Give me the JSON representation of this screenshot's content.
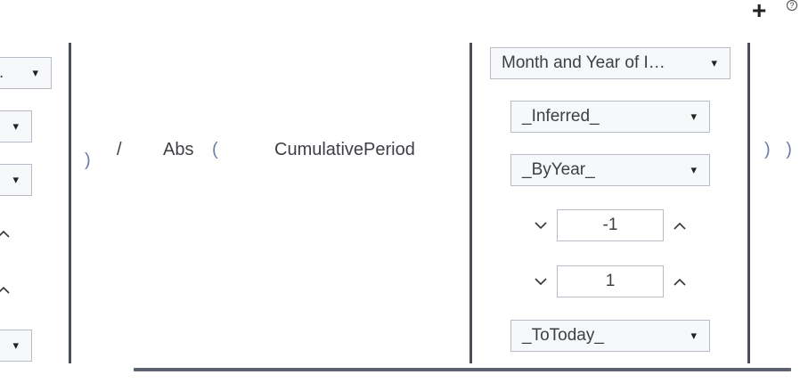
{
  "toolbar": {
    "add_label": "+",
    "help_label": "?"
  },
  "left_column": {
    "dropdown_1_label": ".",
    "dropdown_arrow": "▾"
  },
  "expression": {
    "close_paren_left": ")",
    "divide_operator": "/",
    "abs_function": "Abs",
    "open_paren": "(",
    "cumulative_period_function": "CumulativePeriod",
    "close_parens_right": ") )"
  },
  "params": {
    "month_year": "Month and Year of I…",
    "inferred": "_Inferred_",
    "by_year": "_ByYear_",
    "offset_start": "-1",
    "offset_end": "1",
    "to_today": "_ToToday_"
  },
  "icons": {
    "down_chevron": "chevron-down-icon",
    "up_chevron": "chevron-up-icon",
    "triangle": "triangle-down-icon"
  }
}
